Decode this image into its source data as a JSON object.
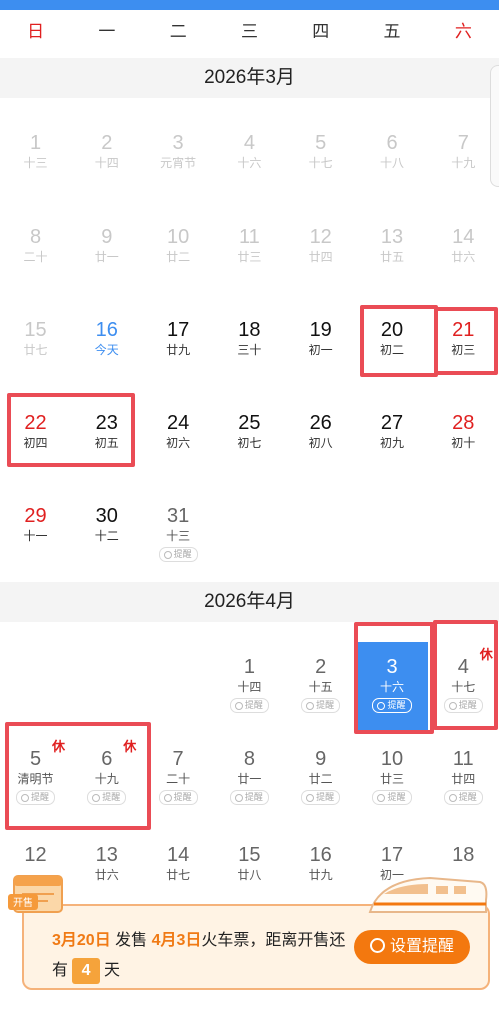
{
  "weekdays": [
    "日",
    "一",
    "二",
    "三",
    "四",
    "五",
    "六"
  ],
  "march": {
    "title": "2026年3月",
    "days": [
      {
        "n": "1",
        "l": "十三",
        "s": "past"
      },
      {
        "n": "2",
        "l": "十四",
        "s": "past"
      },
      {
        "n": "3",
        "l": "元宵节",
        "s": "past"
      },
      {
        "n": "4",
        "l": "十六",
        "s": "past"
      },
      {
        "n": "5",
        "l": "十七",
        "s": "past"
      },
      {
        "n": "6",
        "l": "十八",
        "s": "past"
      },
      {
        "n": "7",
        "l": "十九",
        "s": "past"
      },
      {
        "n": "8",
        "l": "二十",
        "s": "past"
      },
      {
        "n": "9",
        "l": "廿一",
        "s": "past"
      },
      {
        "n": "10",
        "l": "廿二",
        "s": "past"
      },
      {
        "n": "11",
        "l": "廿三",
        "s": "past"
      },
      {
        "n": "12",
        "l": "廿四",
        "s": "past"
      },
      {
        "n": "13",
        "l": "廿五",
        "s": "past"
      },
      {
        "n": "14",
        "l": "廿六",
        "s": "past"
      },
      {
        "n": "15",
        "l": "廿七",
        "s": "past"
      },
      {
        "n": "16",
        "l": "今天",
        "s": "today"
      },
      {
        "n": "17",
        "l": "廿九",
        "s": ""
      },
      {
        "n": "18",
        "l": "三十",
        "s": ""
      },
      {
        "n": "19",
        "l": "初一",
        "s": ""
      },
      {
        "n": "20",
        "l": "初二",
        "s": ""
      },
      {
        "n": "21",
        "l": "初三",
        "s": "weekend"
      },
      {
        "n": "22",
        "l": "初四",
        "s": "weekend"
      },
      {
        "n": "23",
        "l": "初五",
        "s": ""
      },
      {
        "n": "24",
        "l": "初六",
        "s": ""
      },
      {
        "n": "25",
        "l": "初七",
        "s": ""
      },
      {
        "n": "26",
        "l": "初八",
        "s": ""
      },
      {
        "n": "27",
        "l": "初九",
        "s": ""
      },
      {
        "n": "28",
        "l": "初十",
        "s": "weekend"
      },
      {
        "n": "29",
        "l": "十一",
        "s": "weekend"
      },
      {
        "n": "30",
        "l": "十二",
        "s": ""
      },
      {
        "n": "31",
        "l": "十三",
        "s": "muted",
        "r": true
      }
    ]
  },
  "april": {
    "title": "2026年4月",
    "days": [
      {
        "n": "1",
        "l": "十四",
        "s": "muted",
        "r": true
      },
      {
        "n": "2",
        "l": "十五",
        "s": "muted",
        "r": true
      },
      {
        "n": "3",
        "l": "十六",
        "s": "selected",
        "r": true
      },
      {
        "n": "4",
        "l": "十七",
        "s": "muted",
        "r": true,
        "rest": "休"
      },
      {
        "n": "5",
        "l": "清明节",
        "s": "muted",
        "r": true,
        "rest": "休"
      },
      {
        "n": "6",
        "l": "十九",
        "s": "muted",
        "r": true,
        "rest": "休"
      },
      {
        "n": "7",
        "l": "二十",
        "s": "muted",
        "r": true
      },
      {
        "n": "8",
        "l": "廿一",
        "s": "muted",
        "r": true
      },
      {
        "n": "9",
        "l": "廿二",
        "s": "muted",
        "r": true
      },
      {
        "n": "10",
        "l": "廿三",
        "s": "muted",
        "r": true
      },
      {
        "n": "11",
        "l": "廿四",
        "s": "muted",
        "r": true
      },
      {
        "n": "12",
        "l": "",
        "s": "muted"
      },
      {
        "n": "13",
        "l": "廿六",
        "s": "muted"
      },
      {
        "n": "14",
        "l": "廿七",
        "s": "muted"
      },
      {
        "n": "15",
        "l": "廿八",
        "s": "muted"
      },
      {
        "n": "16",
        "l": "廿九",
        "s": "muted"
      },
      {
        "n": "17",
        "l": "初一",
        "s": "muted"
      },
      {
        "n": "18",
        "l": "",
        "s": "muted"
      }
    ]
  },
  "remind_label": "提醒",
  "banner": {
    "date1": "3月20日",
    "text1": " 发售 ",
    "date2": "4月3日",
    "text2": "火车票，距离开售还有",
    "days": "4",
    "text3": "天",
    "button": "设置提醒",
    "badge": "开售"
  },
  "colors": {
    "accent": "#3d8ef0",
    "red": "#e02020",
    "highlight": "#ea4c55",
    "orange": "#f3780f"
  }
}
